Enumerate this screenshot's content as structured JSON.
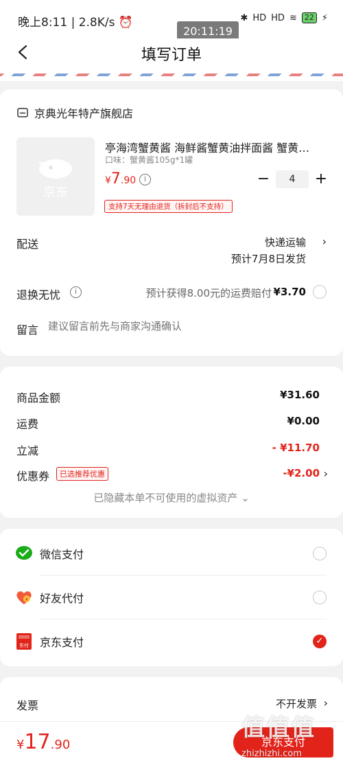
{
  "status_bar": {
    "time_speed": "晚上8:11 | 2.8K/s",
    "alarm": "⏰",
    "bt": "✱",
    "signal1": "HD",
    "signal2": "HD",
    "wifi": "≋",
    "battery": "22",
    "charging": "⚡",
    "overlay_time": "20:11:19"
  },
  "nav": {
    "title": "填写订单"
  },
  "store": {
    "name": "京典光年特产旗舰店"
  },
  "product": {
    "image_label": "京东",
    "title": "亭海湾蟹黄酱 海鲜酱蟹黄油拌面酱 蟹黄…",
    "variant": "口味：蟹黄酱105g*1罐",
    "price_symbol": "¥",
    "price_int": "7",
    "price_dec": ".90",
    "quantity": "4",
    "return_policy": "支持7天无理由退货（拆封后不支持）"
  },
  "delivery": {
    "label": "配送",
    "method": "快递运输",
    "estimate": "预计7月8日发货"
  },
  "worry_free": {
    "label": "退换无忧",
    "text": "预计获得8.00元的运费赔付",
    "price": "¥3.70"
  },
  "message": {
    "label": "留言",
    "placeholder": "建议留言前先与商家沟通确认"
  },
  "amounts": {
    "goods_label": "商品金额",
    "goods_value": "¥31.60",
    "shipping_label": "运费",
    "shipping_value": "¥0.00",
    "discount_label": "立减",
    "discount_value": "- ¥11.70",
    "coupon_label": "优惠券",
    "coupon_tag": "已选推荐优惠",
    "coupon_value": "-¥2.00",
    "hidden_assets": "已隐藏本单不可使用的虚拟资产 ⌄"
  },
  "payment": {
    "wechat": "微信支付",
    "friend": "好友代付",
    "jd": "京东支付",
    "jd_icon_text": "东付",
    "selected": "jd"
  },
  "invoice": {
    "label": "发票",
    "value": "不开发票"
  },
  "bottom": {
    "total_symbol": "¥",
    "total_int": "17",
    "total_dec": ".90",
    "pay_button": "京东支付"
  },
  "watermark": {
    "main": "值值值",
    "sub": "zhizhizhi.com"
  },
  "colors": {
    "accent": "#e2231a",
    "wechat_green": "#1aad19"
  }
}
